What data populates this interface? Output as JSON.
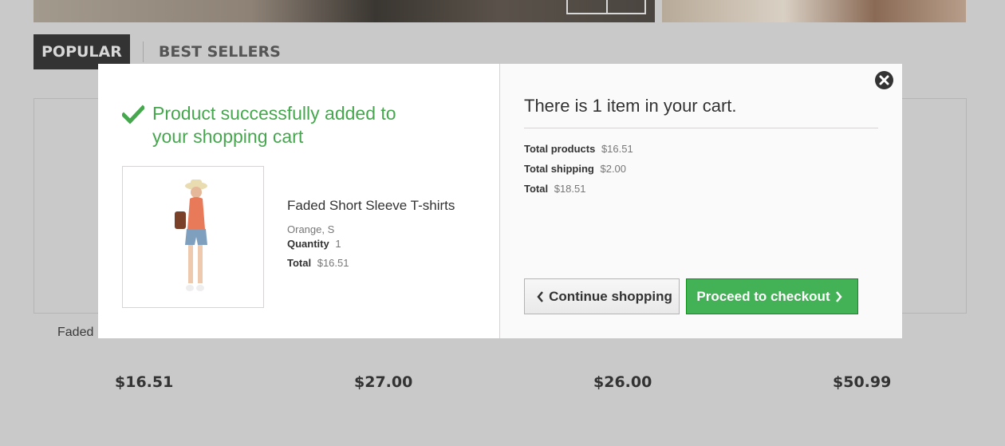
{
  "background": {
    "tabs": [
      "POPULAR",
      "BEST SELLERS"
    ],
    "first_product_name": "Faded",
    "prices": [
      "$16.51",
      "$27.00",
      "$26.00",
      "$50.99"
    ]
  },
  "modal": {
    "success_message": "Product successfully added to your shopping cart",
    "product": {
      "name": "Faded Short Sleeve T-shirts",
      "attributes": "Orange, S",
      "quantity_label": "Quantity",
      "quantity_value": "1",
      "total_label": "Total",
      "total_value": "$16.51"
    },
    "cart": {
      "title": "There is 1 item in your cart.",
      "total_products_label": "Total products",
      "total_products_value": "$16.51",
      "total_shipping_label": "Total shipping",
      "total_shipping_value": "$2.00",
      "total_label": "Total",
      "total_value": "$18.51"
    },
    "buttons": {
      "continue_label": "Continue shopping",
      "checkout_label": "Proceed to checkout"
    }
  },
  "colors": {
    "accent_green": "#46a74e",
    "checkout_green": "#43b155",
    "overlay_grey": "#c9c9c9"
  },
  "icons": [
    "check-icon",
    "close-icon",
    "chevron-left-icon",
    "chevron-right-icon"
  ]
}
